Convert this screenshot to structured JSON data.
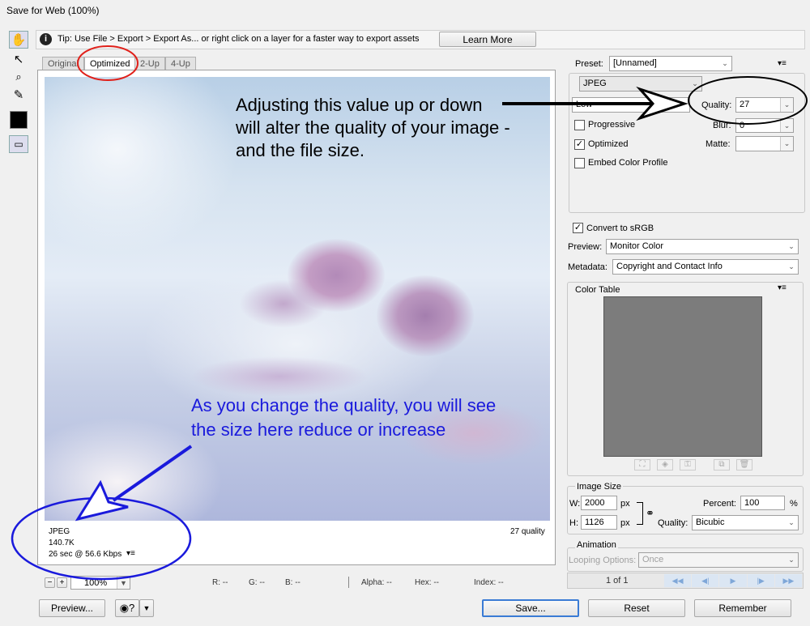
{
  "window": {
    "title": "Save for Web (100%)"
  },
  "tip": {
    "text": "Tip: Use File > Export > Export As...  or right click on a layer for a faster way to export assets",
    "learn_more": "Learn More"
  },
  "tools": [
    {
      "name": "hand-tool-icon",
      "glyph": "✋"
    },
    {
      "name": "slice-select-tool-icon",
      "glyph": "↖"
    },
    {
      "name": "zoom-tool-icon",
      "glyph": "🔍"
    },
    {
      "name": "eyedropper-tool-icon",
      "glyph": "✎"
    }
  ],
  "tabs": [
    {
      "label": "Original"
    },
    {
      "label": "Optimized"
    },
    {
      "label": "2-Up"
    },
    {
      "label": "4-Up"
    }
  ],
  "preview_info": {
    "format": "JPEG",
    "size": "140.7K",
    "time": "26 sec @ 56.6 Kbps",
    "quality": "27 quality"
  },
  "annotations": {
    "quality_callout": [
      "Adjusting this value up or down",
      "will alter the quality of your image -",
      "and the file size."
    ],
    "size_callout": [
      "As you change the quality, you will see",
      "the size here reduce or increase"
    ]
  },
  "settings": {
    "preset_label": "Preset:",
    "preset_value": "[Unnamed]",
    "format": "JPEG",
    "compression": "Low",
    "quality_label": "Quality:",
    "quality_value": "27",
    "progressive_label": "Progressive",
    "progressive": false,
    "blur_label": "Blur:",
    "blur_value": "0",
    "optimized_label": "Optimized",
    "optimized": true,
    "matte_label": "Matte:",
    "matte_value": "",
    "embed_label": "Embed Color Profile",
    "embed": false,
    "convert_label": "Convert to sRGB",
    "convert": true,
    "preview_label": "Preview:",
    "preview_value": "Monitor Color",
    "metadata_label": "Metadata:",
    "metadata_value": "Copyright and Contact Info"
  },
  "color_table": {
    "title": "Color Table"
  },
  "image_size": {
    "title": "Image Size",
    "w_label": "W:",
    "w_value": "2000",
    "h_label": "H:",
    "h_value": "1126",
    "unit": "px",
    "percent_label": "Percent:",
    "percent_value": "100",
    "percent_unit": "%",
    "quality_label": "Quality:",
    "quality_value": "Bicubic"
  },
  "animation": {
    "title": "Animation",
    "looping_label": "Looping Options:",
    "looping_value": "Once",
    "frame": "1 of 1"
  },
  "statusbar": {
    "zoom": "100%",
    "r": "R: --",
    "g": "G: --",
    "b": "B: --",
    "alpha": "Alpha: --",
    "hex": "Hex: --",
    "index": "Index: --"
  },
  "buttons": {
    "preview": "Preview...",
    "save": "Save...",
    "reset": "Reset",
    "remember": "Remember"
  },
  "colors": {
    "annotation_black": "#000000",
    "annotation_blue": "#1a1adc",
    "highlight_red": "#e0201a"
  }
}
